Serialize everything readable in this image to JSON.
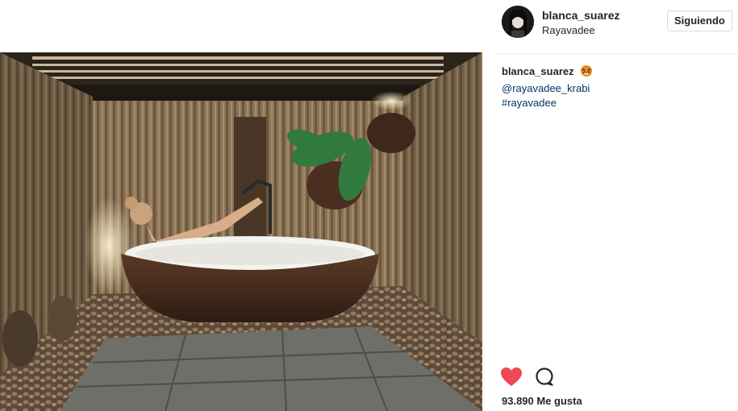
{
  "post": {
    "username": "blanca_suarez",
    "location": "Rayavadee",
    "follow_label": "Siguiendo",
    "caption_user": "blanca_suarez",
    "caption_lines": [
      "@rayavadee_krabi",
      "#rayavadee"
    ],
    "likes_text": "93.890 Me gusta"
  },
  "icons": {
    "like": "heart-icon",
    "comment": "comment-icon",
    "caption_emoji": "tiger-emoji-icon"
  },
  "colors": {
    "heart": "#ed4956",
    "link": "#003569",
    "border": "#efefef"
  }
}
